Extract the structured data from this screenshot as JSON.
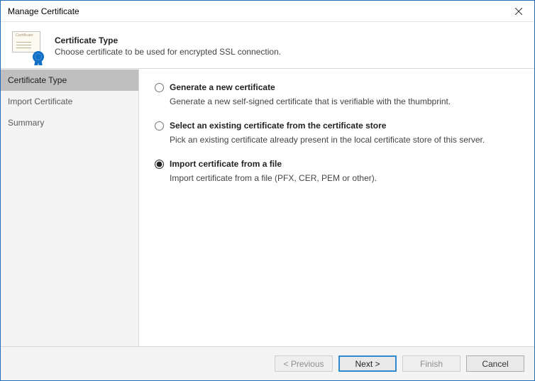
{
  "window": {
    "title": "Manage Certificate"
  },
  "header": {
    "title": "Certificate Type",
    "subtitle": "Choose certificate to be used for encrypted SSL connection.",
    "cert_word": "Certificate"
  },
  "sidebar": {
    "items": [
      {
        "label": "Certificate Type",
        "selected": true
      },
      {
        "label": "Import Certificate",
        "selected": false
      },
      {
        "label": "Summary",
        "selected": false
      }
    ]
  },
  "options": [
    {
      "id": "generate",
      "label": "Generate a new certificate",
      "desc": "Generate a new self-signed certificate that is verifiable with the thumbprint.",
      "selected": false
    },
    {
      "id": "select-store",
      "label": "Select an existing certificate from the certificate store",
      "desc": "Pick an existing certificate already present in the local certificate store of this server.",
      "selected": false
    },
    {
      "id": "import-file",
      "label": "Import certificate from a file",
      "desc": "Import certificate from a file (PFX, CER, PEM or other).",
      "selected": true
    }
  ],
  "footer": {
    "previous": "< Previous",
    "next": "Next >",
    "finish": "Finish",
    "cancel": "Cancel"
  }
}
